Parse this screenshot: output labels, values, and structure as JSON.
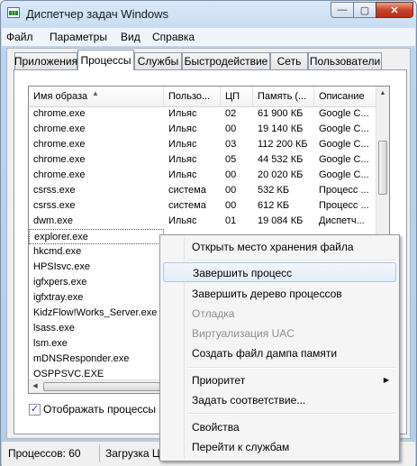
{
  "window": {
    "title": "Диспетчер задач Windows",
    "min_glyph": "—",
    "max_glyph": "▢",
    "close_glyph": "✕"
  },
  "menu": [
    "Файл",
    "Параметры",
    "Вид",
    "Справка"
  ],
  "tabs": [
    "Приложения",
    "Процессы",
    "Службы",
    "Быстродействие",
    "Сеть",
    "Пользователи"
  ],
  "active_tab": "Процессы",
  "columns": [
    "Имя образа",
    "Пользо...",
    "ЦП",
    "Память (...",
    "Описание"
  ],
  "rows": [
    [
      "chrome.exe",
      "Ильяс",
      "02",
      "61 900 КБ",
      "Google C..."
    ],
    [
      "chrome.exe",
      "Ильяс",
      "00",
      "19 140 КБ",
      "Google C..."
    ],
    [
      "chrome.exe",
      "Ильяс",
      "03",
      "112 200 КБ",
      "Google C..."
    ],
    [
      "chrome.exe",
      "Ильяс",
      "05",
      "44 532 КБ",
      "Google C..."
    ],
    [
      "chrome.exe",
      "Ильяс",
      "00",
      "20 020 КБ",
      "Google C..."
    ],
    [
      "csrss.exe",
      "система",
      "00",
      "532 КБ",
      "Процесс ..."
    ],
    [
      "csrss.exe",
      "система",
      "00",
      "612 КБ",
      "Процесс ..."
    ],
    [
      "dwm.exe",
      "Ильяс",
      "01",
      "19 084 КБ",
      "Диспетч..."
    ],
    [
      "explorer.exe",
      "",
      "",
      "",
      ""
    ],
    [
      "hkcmd.exe",
      "",
      "",
      "",
      ""
    ],
    [
      "HPSIsvc.exe",
      "",
      "",
      "",
      ""
    ],
    [
      "igfxpers.exe",
      "",
      "",
      "",
      ""
    ],
    [
      "igfxtray.exe",
      "",
      "",
      "",
      ""
    ],
    [
      "KidzFlow!Works_Server.exe",
      "",
      "",
      "",
      ""
    ],
    [
      "lsass.exe",
      "",
      "",
      "",
      ""
    ],
    [
      "lsm.exe",
      "",
      "",
      "",
      ""
    ],
    [
      "mDNSResponder.exe",
      "",
      "",
      "",
      ""
    ],
    [
      "OSPPSVC.EXE",
      "",
      "",
      "",
      ""
    ]
  ],
  "selected_row": "explorer.exe",
  "show_all_processes": {
    "label": "Отображать процессы все",
    "checked": true,
    "check_glyph": "✓"
  },
  "status": {
    "processes": "Процессов: 60",
    "cpu": "Загрузка ЦП"
  },
  "context_menu": [
    {
      "label": "Открыть место хранения файла",
      "state": "normal"
    },
    {
      "label": "Завершить процесс",
      "state": "highlighted"
    },
    {
      "label": "Завершить дерево процессов",
      "state": "normal"
    },
    {
      "label": "Отладка",
      "state": "disabled"
    },
    {
      "label": "Виртуализация UAC",
      "state": "disabled"
    },
    {
      "label": "Создать файл дампа памяти",
      "state": "normal"
    },
    {
      "label": "Приоритет",
      "state": "normal",
      "submenu": true
    },
    {
      "label": "Задать соответствие...",
      "state": "normal"
    },
    {
      "label": "Свойства",
      "state": "normal"
    },
    {
      "label": "Перейти к службам",
      "state": "normal"
    }
  ]
}
